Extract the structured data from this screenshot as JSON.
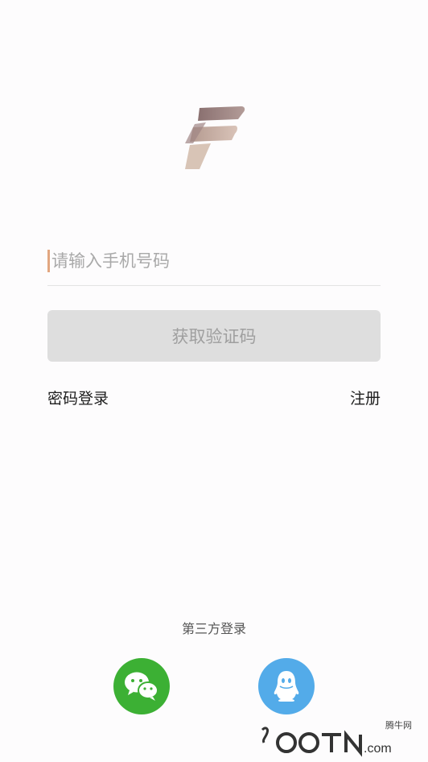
{
  "login": {
    "phone_placeholder": "请输入手机号码",
    "get_code_label": "获取验证码",
    "password_login_label": "密码登录",
    "register_label": "注册"
  },
  "third_party": {
    "title": "第三方登录",
    "providers": [
      {
        "name": "wechat",
        "icon": "wechat-icon",
        "color": "#3cb034"
      },
      {
        "name": "qq",
        "icon": "qq-icon",
        "color": "#53abe9"
      }
    ]
  },
  "watermark": {
    "text": "QQTN.com",
    "small_text": "腾牛网"
  },
  "colors": {
    "accent_caret": "#e2a680",
    "button_bg": "#dedede",
    "button_text": "#9f9f9f"
  }
}
